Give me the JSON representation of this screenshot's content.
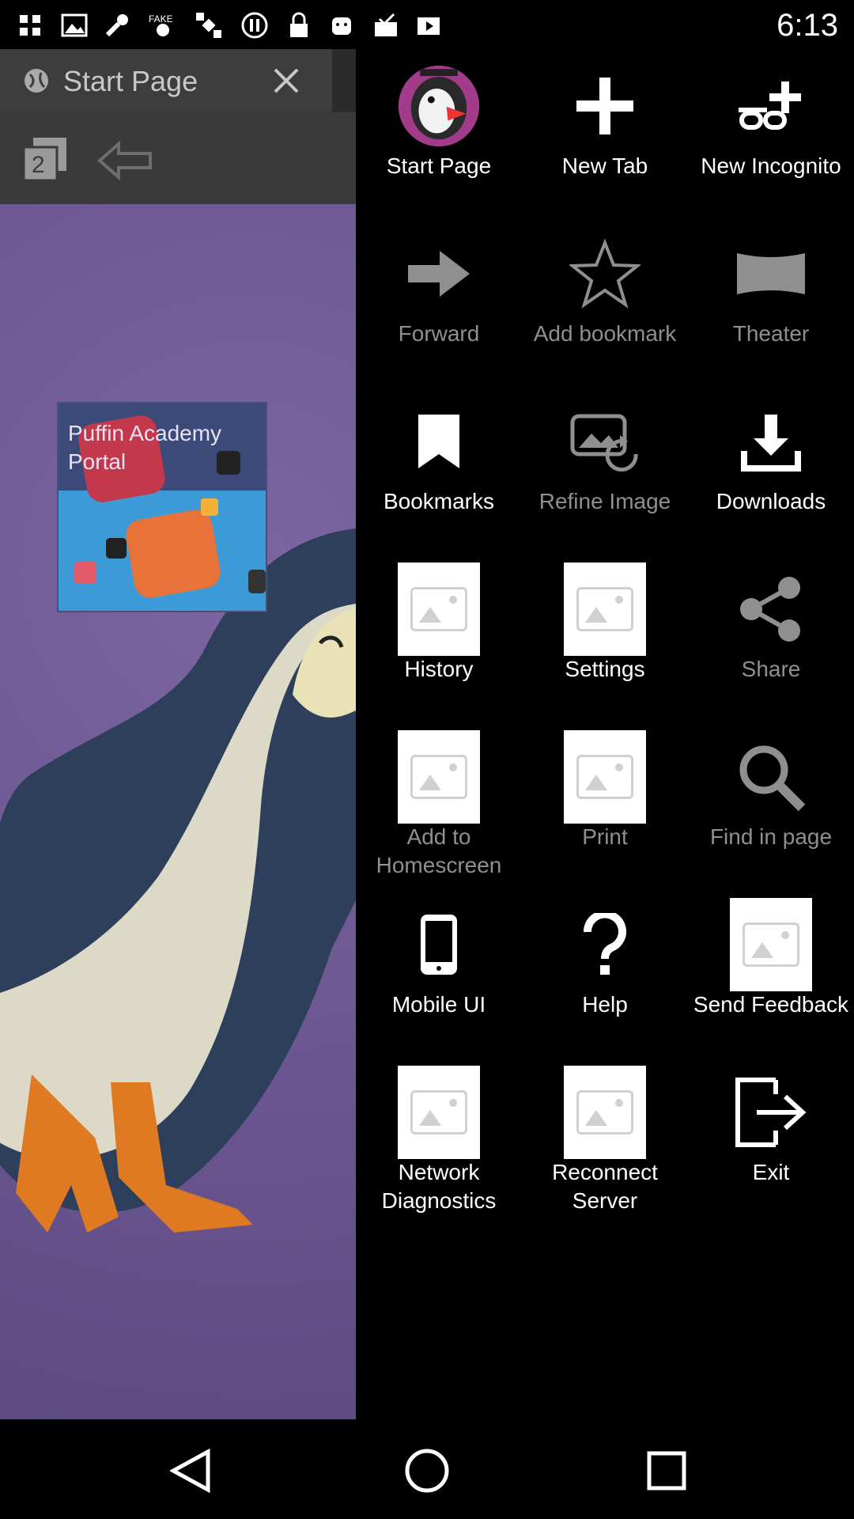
{
  "status_bar": {
    "time": "6:13",
    "icons": [
      "notification-icon",
      "picture-icon",
      "wrench-icon",
      "fake-gps-icon",
      "satellite-icon",
      "pause-circle-icon",
      "lock-icon",
      "android-icon",
      "check-inbox-icon",
      "play-store-icon"
    ]
  },
  "browser": {
    "tab_title": "Start Page",
    "tab_count": "2",
    "page": {
      "portal_title": "Puffin Academy Portal"
    }
  },
  "menu": {
    "items": [
      {
        "label": "Start Page",
        "icon": "puffin-logo-icon",
        "enabled": true
      },
      {
        "label": "New Tab",
        "icon": "plus-icon",
        "enabled": true
      },
      {
        "label": "New Incognito",
        "icon": "incognito-icon",
        "enabled": true
      },
      {
        "label": "Forward",
        "icon": "arrow-forward-icon",
        "enabled": false
      },
      {
        "label": "Add bookmark",
        "icon": "star-icon",
        "enabled": false
      },
      {
        "label": "Theater",
        "icon": "theater-icon",
        "enabled": false
      },
      {
        "label": "Bookmarks",
        "icon": "bookmark-icon",
        "enabled": true
      },
      {
        "label": "Refine Image",
        "icon": "refine-image-icon",
        "enabled": false
      },
      {
        "label": "Downloads",
        "icon": "download-icon",
        "enabled": true
      },
      {
        "label": "History",
        "icon": "image-placeholder-icon",
        "enabled": true
      },
      {
        "label": "Settings",
        "icon": "image-placeholder-icon",
        "enabled": true
      },
      {
        "label": "Share",
        "icon": "share-icon",
        "enabled": false
      },
      {
        "label": "Add to Homescreen",
        "icon": "image-placeholder-icon",
        "enabled": false
      },
      {
        "label": "Print",
        "icon": "image-placeholder-icon",
        "enabled": false
      },
      {
        "label": "Find in page",
        "icon": "search-icon",
        "enabled": false
      },
      {
        "label": "Mobile UI",
        "icon": "phone-icon",
        "enabled": true
      },
      {
        "label": "Help",
        "icon": "question-icon",
        "enabled": true
      },
      {
        "label": "Send Feedback",
        "icon": "image-placeholder-icon",
        "enabled": true
      },
      {
        "label": "Network Diagnostics",
        "icon": "image-placeholder-icon",
        "enabled": true
      },
      {
        "label": "Reconnect Server",
        "icon": "image-placeholder-icon",
        "enabled": true
      },
      {
        "label": "Exit",
        "icon": "exit-icon",
        "enabled": true
      }
    ]
  },
  "nav_bar": {
    "buttons": [
      "back-icon",
      "home-icon",
      "recents-icon"
    ]
  },
  "colors": {
    "menu_bg": "#000000",
    "enabled_text": "#ffffff",
    "disabled_text": "#8f8f8f",
    "page_bg": "#6f5a93"
  }
}
